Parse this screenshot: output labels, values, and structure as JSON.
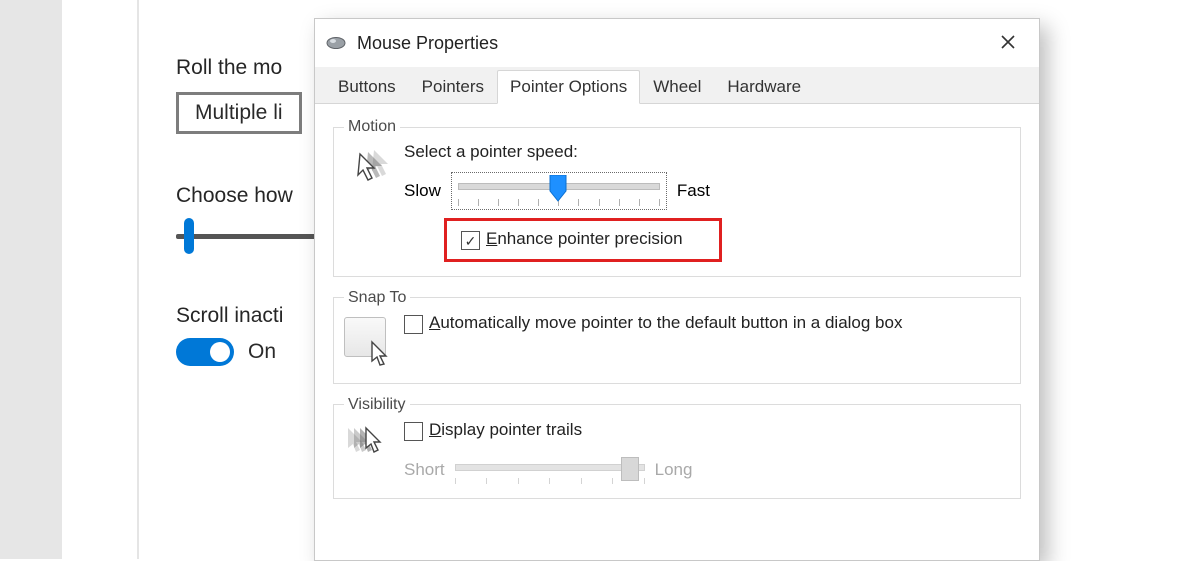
{
  "bg": {
    "roll_label": "Roll the mo",
    "roll_value": "Multiple li",
    "choose_label": "Choose how",
    "scroll_label": "Scroll inacti",
    "toggle_label": "On"
  },
  "dialog": {
    "title": "Mouse Properties",
    "tabs": [
      "Buttons",
      "Pointers",
      "Pointer Options",
      "Wheel",
      "Hardware"
    ],
    "active_tab_index": 2,
    "motion": {
      "legend": "Motion",
      "speed_label": "Select a pointer speed:",
      "slow": "Slow",
      "fast": "Fast",
      "enhance_label": "Enhance pointer precision",
      "enhance_checked": true
    },
    "snap": {
      "legend": "Snap To",
      "auto_label": "Automatically move pointer to the default button in a dialog box",
      "auto_checked": false
    },
    "visibility": {
      "legend": "Visibility",
      "trails_label": "Display pointer trails",
      "trails_checked": false,
      "short": "Short",
      "long": "Long"
    }
  }
}
